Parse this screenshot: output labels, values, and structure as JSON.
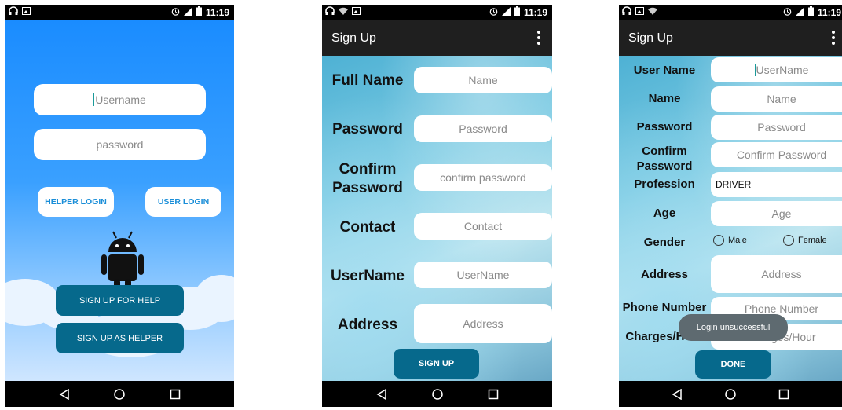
{
  "status_time": "11:19",
  "screen1": {
    "username_placeholder": "Username",
    "password_placeholder": "password",
    "helper_login": "HELPER LOGIN",
    "user_login": "USER LOGIN",
    "sign_up_for_help": "SIGN UP FOR HELP",
    "sign_up_as_helper": "SIGN UP AS HELPER"
  },
  "screen2": {
    "title": "Sign Up",
    "labels": {
      "full_name": "Full Name",
      "password": "Password",
      "confirm_password": "Confirm Password",
      "contact": "Contact",
      "username": "UserName",
      "address": "Address"
    },
    "placeholders": {
      "name": "Name",
      "password": "Password",
      "confirm_password": "confirm password",
      "contact": "Contact",
      "username": "UserName",
      "address": "Address"
    },
    "sign_up": "SIGN UP"
  },
  "screen3": {
    "title": "Sign Up",
    "labels": {
      "user_name": "User Name",
      "name": "Name",
      "password": "Password",
      "confirm_password": "Confirm Password",
      "profession": "Profession",
      "age": "Age",
      "gender": "Gender",
      "address": "Address",
      "phone_number": "Phone Number",
      "charges_hour": "Charges/Hour"
    },
    "placeholders": {
      "user_name": "UserName",
      "name": "Name",
      "password": "Password",
      "confirm_password": "Confirm Password",
      "age": "Age",
      "address": "Address",
      "phone_number": "Phone Number",
      "charges_hour": "Charges/Hour"
    },
    "profession_value": "DRIVER",
    "gender_male": "Male",
    "gender_female": "Female",
    "toast": "Login unsuccessful",
    "done": "DONE"
  },
  "colors": {
    "primary_button": "#06698c",
    "sky_top": "#1a8cff",
    "app_bar": "#1f1f1f"
  }
}
